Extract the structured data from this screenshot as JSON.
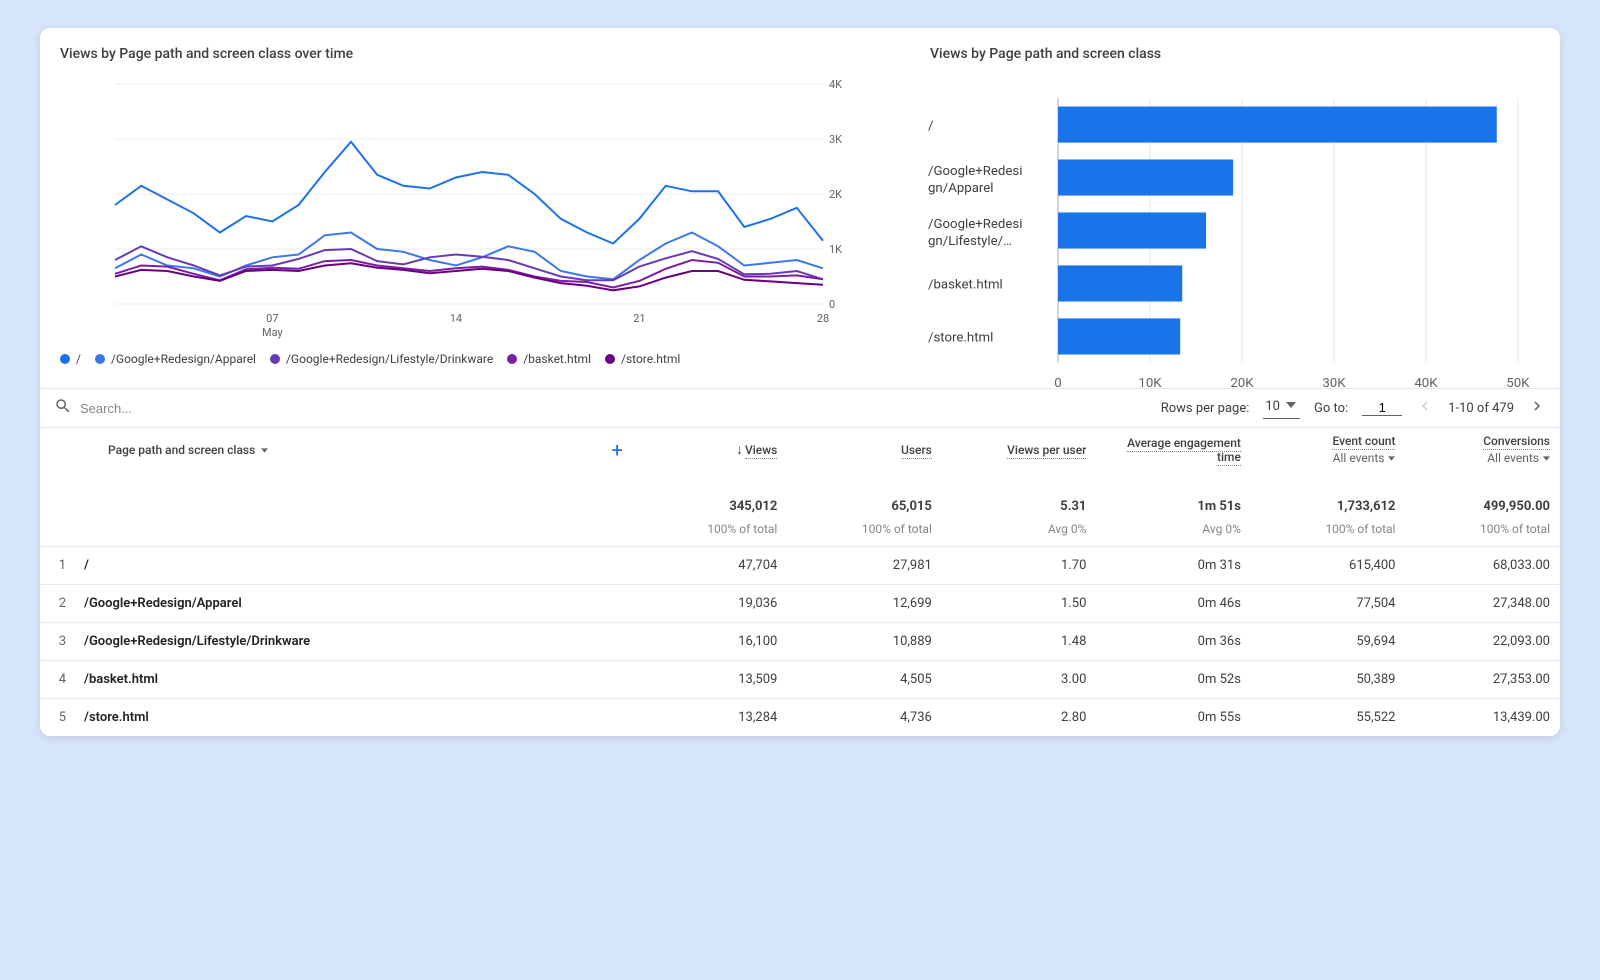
{
  "chart_data": [
    {
      "type": "line",
      "title": "Views by Page path and screen class over time",
      "x_categories": [
        "01",
        "02",
        "03",
        "04",
        "05",
        "06",
        "07",
        "08",
        "09",
        "10",
        "11",
        "12",
        "13",
        "14",
        "15",
        "16",
        "17",
        "18",
        "19",
        "20",
        "21",
        "22",
        "23",
        "24",
        "25",
        "26",
        "27",
        "28"
      ],
      "x_ticks_shown": [
        "07",
        "14",
        "21",
        "28"
      ],
      "x_sub_label": "May",
      "y_ticks": [
        "0",
        "1K",
        "2K",
        "3K",
        "4K"
      ],
      "ylim": [
        0,
        4000
      ],
      "series": [
        {
          "name": "/",
          "color": "#1a73e8",
          "values": [
            1800,
            2150,
            1900,
            1650,
            1300,
            1600,
            1500,
            1800,
            2400,
            2950,
            2350,
            2150,
            2100,
            2300,
            2400,
            2350,
            2000,
            1550,
            1300,
            1100,
            1550,
            2150,
            2050,
            2050,
            1400,
            1550,
            1750,
            1150
          ]
        },
        {
          "name": "/Google+Redesign/Apparel",
          "color": "#3b78e7",
          "values": [
            650,
            900,
            700,
            650,
            500,
            700,
            850,
            900,
            1250,
            1300,
            1000,
            950,
            800,
            700,
            850,
            1050,
            950,
            600,
            500,
            450,
            800,
            1100,
            1300,
            1050,
            700,
            750,
            800,
            650
          ]
        },
        {
          "name": "/Google+Redesign/Lifestyle/Drinkware",
          "color": "#673ab7",
          "values": [
            800,
            1050,
            850,
            700,
            520,
            680,
            700,
            820,
            980,
            1000,
            780,
            720,
            850,
            900,
            860,
            800,
            650,
            500,
            430,
            430,
            680,
            830,
            960,
            820,
            540,
            550,
            600,
            450
          ]
        },
        {
          "name": "/basket.html",
          "color": "#7b1fa2",
          "values": [
            550,
            700,
            680,
            550,
            430,
            630,
            660,
            640,
            780,
            800,
            700,
            650,
            600,
            650,
            680,
            620,
            500,
            420,
            400,
            300,
            420,
            640,
            800,
            750,
            500,
            500,
            520,
            450
          ]
        },
        {
          "name": "/store.html",
          "color": "#6a0080",
          "values": [
            500,
            620,
            600,
            500,
            420,
            600,
            620,
            600,
            700,
            740,
            660,
            620,
            560,
            600,
            640,
            600,
            480,
            380,
            330,
            250,
            320,
            480,
            600,
            600,
            440,
            410,
            380,
            350
          ]
        }
      ],
      "legend_items": [
        {
          "label": "/",
          "color": "#1a73e8"
        },
        {
          "label": "/Google+Redesign/Apparel",
          "color": "#3b78e7"
        },
        {
          "label": "/Google+Redesign/Lifestyle/Drinkware",
          "color": "#673ab7"
        },
        {
          "label": "/basket.html",
          "color": "#7b1fa2"
        },
        {
          "label": "/store.html",
          "color": "#6a0080"
        }
      ]
    },
    {
      "type": "bar",
      "orientation": "horizontal",
      "title": "Views by Page path and screen class",
      "categories_display": [
        "/",
        "/Google+Redesign/Apparel",
        "/Google+Redesign/Lifestyle/…",
        "/basket.html",
        "/store.html"
      ],
      "categories": [
        "/",
        "/Google+Redesign/Apparel",
        "/Google+Redesign/Lifestyle/Drinkware",
        "/basket.html",
        "/store.html"
      ],
      "values": [
        47704,
        19036,
        16100,
        13509,
        13284
      ],
      "x_ticks": [
        "0",
        "10K",
        "20K",
        "30K",
        "40K",
        "50K"
      ],
      "xlim": [
        0,
        50000
      ]
    }
  ],
  "search": {
    "placeholder": "Search..."
  },
  "pager": {
    "rows_label": "Rows per page:",
    "rows_value": "10",
    "goto_label": "Go to:",
    "goto_value": "1",
    "range": "1-10 of 479"
  },
  "table": {
    "first_header": "Page path and screen class",
    "columns": [
      {
        "key": "views",
        "label": "Views",
        "sub": "",
        "sort_desc": true
      },
      {
        "key": "users",
        "label": "Users",
        "sub": ""
      },
      {
        "key": "vpu",
        "label": "Views per user",
        "sub": ""
      },
      {
        "key": "aet",
        "label": "Average engagement time",
        "sub": ""
      },
      {
        "key": "events",
        "label": "Event count",
        "sub": "All events"
      },
      {
        "key": "conv",
        "label": "Conversions",
        "sub": "All events"
      }
    ],
    "totals": {
      "views": "345,012",
      "users": "65,015",
      "vpu": "5.31",
      "aet": "1m 51s",
      "events": "1,733,612",
      "conv": "499,950.00"
    },
    "totals_sub": {
      "views": "100% of total",
      "users": "100% of total",
      "vpu": "Avg 0%",
      "aet": "Avg 0%",
      "events": "100% of total",
      "conv": "100% of total"
    },
    "rows": [
      {
        "idx": "1",
        "path": "/",
        "views": "47,704",
        "users": "27,981",
        "vpu": "1.70",
        "aet": "0m 31s",
        "events": "615,400",
        "conv": "68,033.00"
      },
      {
        "idx": "2",
        "path": "/Google+Redesign/Apparel",
        "views": "19,036",
        "users": "12,699",
        "vpu": "1.50",
        "aet": "0m 46s",
        "events": "77,504",
        "conv": "27,348.00"
      },
      {
        "idx": "3",
        "path": "/Google+Redesign/Lifestyle/Drinkware",
        "views": "16,100",
        "users": "10,889",
        "vpu": "1.48",
        "aet": "0m 36s",
        "events": "59,694",
        "conv": "22,093.00"
      },
      {
        "idx": "4",
        "path": "/basket.html",
        "views": "13,509",
        "users": "4,505",
        "vpu": "3.00",
        "aet": "0m 52s",
        "events": "50,389",
        "conv": "27,353.00"
      },
      {
        "idx": "5",
        "path": "/store.html",
        "views": "13,284",
        "users": "4,736",
        "vpu": "2.80",
        "aet": "0m 55s",
        "events": "55,522",
        "conv": "13,439.00"
      }
    ]
  }
}
